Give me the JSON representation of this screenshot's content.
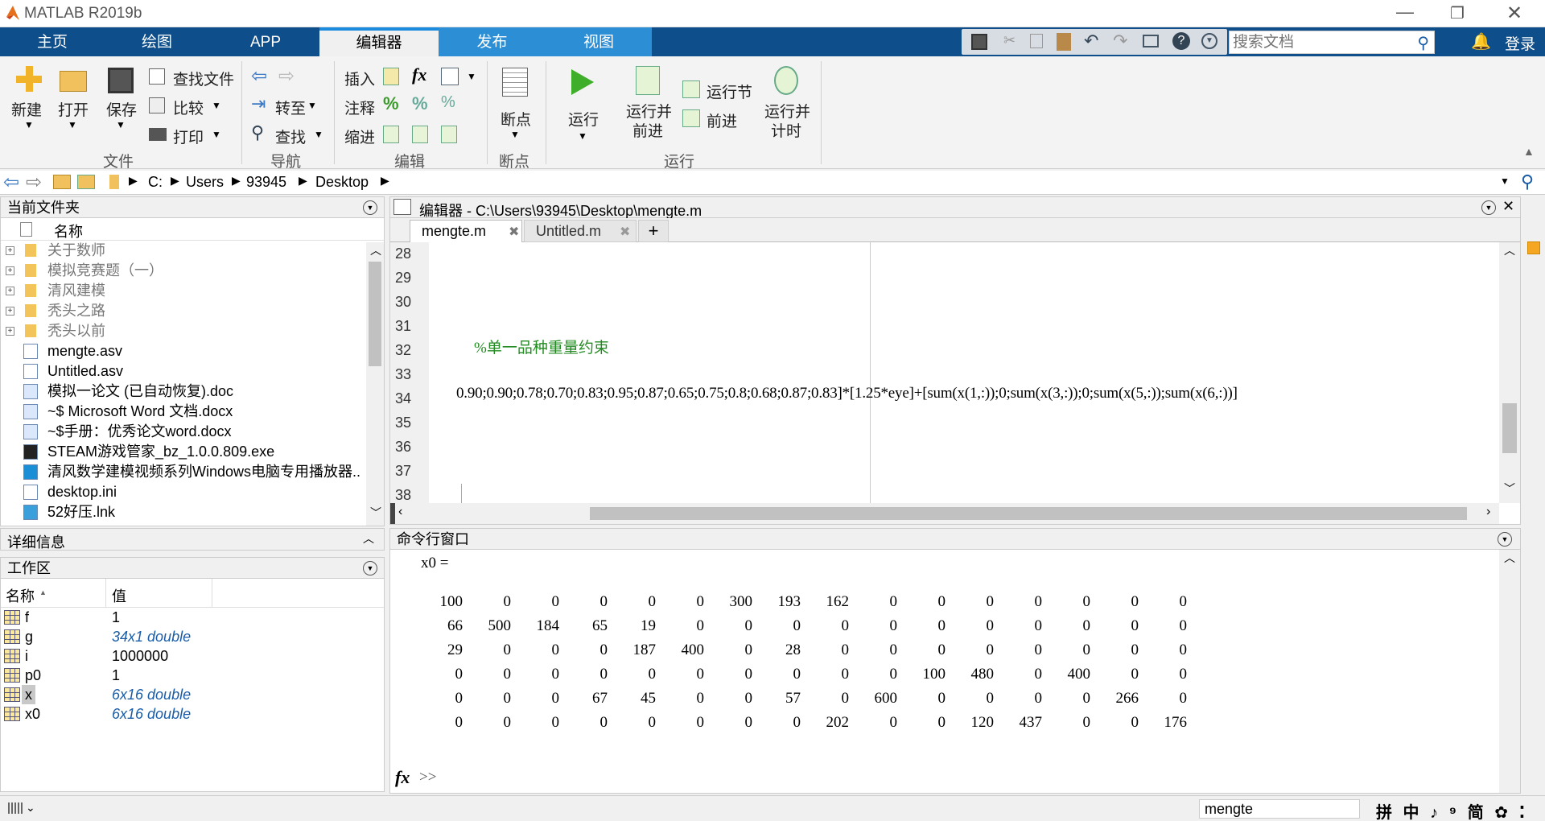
{
  "app": {
    "title": "MATLAB R2019b"
  },
  "tabs": [
    "主页",
    "绘图",
    "APP",
    "编辑器",
    "发布",
    "视图"
  ],
  "search": {
    "placeholder": "搜索文档"
  },
  "login": "登录",
  "ribbon": {
    "file": {
      "new": "新建",
      "open": "打开",
      "save": "保存",
      "find_files": "查找文件",
      "compare": "比较",
      "print": "打印",
      "group": "文件"
    },
    "nav": {
      "goto": "转至",
      "find": "查找",
      "group": "导航"
    },
    "edit": {
      "insert": "插入",
      "comment": "注释",
      "indent": "缩进",
      "fx": "fx",
      "group": "编辑"
    },
    "breakpoints": {
      "label": "断点",
      "group": "断点"
    },
    "run": {
      "run": "运行",
      "run_advance_1": "运行并",
      "run_advance_2": "前进",
      "run_section": "运行节",
      "advance": "前进",
      "run_time_1": "运行并",
      "run_time_2": "计时",
      "group": "运行"
    }
  },
  "address": {
    "parts": [
      "C:",
      "Users",
      "93945",
      "Desktop"
    ]
  },
  "current_folder": {
    "title": "当前文件夹",
    "col_name": "名称",
    "items": [
      {
        "name": "关于数师",
        "type": "folder"
      },
      {
        "name": "模拟竞赛题（一）",
        "type": "folder"
      },
      {
        "name": "清风建模",
        "type": "folder"
      },
      {
        "name": "秃头之路",
        "type": "folder"
      },
      {
        "name": "秃头以前",
        "type": "folder"
      },
      {
        "name": "mengte.asv",
        "type": "file"
      },
      {
        "name": "Untitled.asv",
        "type": "file"
      },
      {
        "name": "模拟一论文 (已自动恢复).doc",
        "type": "doc"
      },
      {
        "name": "~$ Microsoft Word 文档.docx",
        "type": "doc"
      },
      {
        "name": "~$手册：优秀论文word.docx",
        "type": "doc"
      },
      {
        "name": "STEAM游戏管家_bz_1.0.0.809.exe",
        "type": "exe"
      },
      {
        "name": "清风数学建模视频系列Windows电脑专用播放器..",
        "type": "exe2"
      },
      {
        "name": "desktop.ini",
        "type": "ini"
      },
      {
        "name": "52好压.lnk",
        "type": "lnk"
      }
    ]
  },
  "details": {
    "title": "详细信息"
  },
  "workspace": {
    "title": "工作区",
    "col_name": "名称",
    "col_value": "值",
    "vars": [
      {
        "name": "f",
        "value": "1",
        "italic": false
      },
      {
        "name": "g",
        "value": "34x1 double",
        "italic": true
      },
      {
        "name": "i",
        "value": "1000000",
        "italic": false
      },
      {
        "name": "p0",
        "value": "1",
        "italic": false
      },
      {
        "name": "x",
        "value": "6x16 double",
        "italic": true
      },
      {
        "name": "x0",
        "value": "6x16 double",
        "italic": true
      }
    ]
  },
  "editor": {
    "title": "编辑器 - C:\\Users\\93945\\Desktop\\mengte.m",
    "tabs": [
      "mengte.m",
      "Untitled.m"
    ],
    "line_numbers": [
      "28",
      "29",
      "30",
      "31",
      "32",
      "33",
      "34",
      "35",
      "36",
      "37",
      "38"
    ],
    "comment_line": "%单一品种重量约束",
    "code_line": "0.90;0.90;0.78;0.70;0.83;0.95;0.87;0.65;0.75;0.8;0.68;0.87;0.83]*[1.25*eye]+[sum(x(1,:));0;sum(x(3,:));0;sum(x(5,:));sum(x(6,:))]"
  },
  "command": {
    "title": "命令行窗口",
    "var_line": "x0 =",
    "matrix": [
      [
        100,
        0,
        0,
        0,
        0,
        0,
        300,
        193,
        162,
        0,
        0,
        0,
        0,
        0,
        0,
        0
      ],
      [
        66,
        500,
        184,
        65,
        19,
        0,
        0,
        0,
        0,
        0,
        0,
        0,
        0,
        0,
        0,
        0
      ],
      [
        29,
        0,
        0,
        0,
        187,
        400,
        0,
        28,
        0,
        0,
        0,
        0,
        0,
        0,
        0,
        0
      ],
      [
        0,
        0,
        0,
        0,
        0,
        0,
        0,
        0,
        0,
        0,
        100,
        480,
        0,
        400,
        0,
        0
      ],
      [
        0,
        0,
        0,
        67,
        45,
        0,
        0,
        57,
        0,
        600,
        0,
        0,
        0,
        0,
        266,
        0
      ],
      [
        0,
        0,
        0,
        0,
        0,
        0,
        0,
        0,
        202,
        0,
        0,
        120,
        437,
        0,
        0,
        176
      ]
    ],
    "prompt": ">>"
  },
  "status": {
    "script": "mengte",
    "ime": "拼 中 ♪ ⁹ 简 ✿ ⁚"
  }
}
